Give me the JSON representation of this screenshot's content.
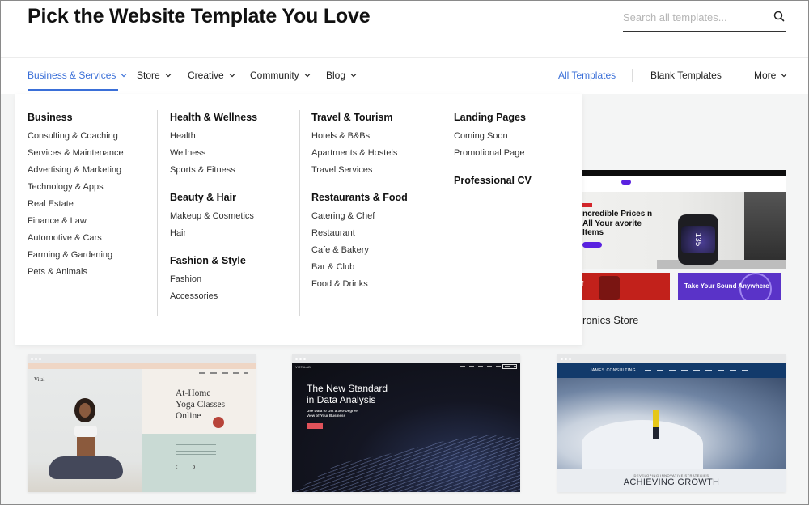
{
  "header": {
    "title": "Pick the Website Template You Love",
    "search_placeholder": "Search all templates...",
    "search_value": ""
  },
  "nav": {
    "left": [
      {
        "label": "Business & Services",
        "active": true,
        "has_dropdown": true
      },
      {
        "label": "Store",
        "active": false,
        "has_dropdown": true
      },
      {
        "label": "Creative",
        "active": false,
        "has_dropdown": true
      },
      {
        "label": "Community",
        "active": false,
        "has_dropdown": true
      },
      {
        "label": "Blog",
        "active": false,
        "has_dropdown": true
      }
    ],
    "right": [
      {
        "label": "All Templates",
        "active": true
      },
      {
        "label": "Blank Templates",
        "active": false
      },
      {
        "label": "More",
        "has_dropdown": true
      }
    ],
    "accent_color": "#3a6fd8"
  },
  "dropdown": {
    "columns": [
      {
        "groups": [
          {
            "title": "Business",
            "links": [
              "Consulting & Coaching",
              "Services & Maintenance",
              "Advertising & Marketing",
              "Technology & Apps",
              "Real Estate",
              "Finance & Law",
              "Automotive & Cars",
              "Farming & Gardening",
              "Pets & Animals"
            ]
          }
        ]
      },
      {
        "groups": [
          {
            "title": "Health & Wellness",
            "links": [
              "Health",
              "Wellness",
              "Sports & Fitness"
            ]
          },
          {
            "title": "Beauty & Hair",
            "links": [
              "Makeup & Cosmetics",
              "Hair"
            ]
          },
          {
            "title": "Fashion & Style",
            "links": [
              "Fashion",
              "Accessories"
            ]
          }
        ]
      },
      {
        "groups": [
          {
            "title": "Travel & Tourism",
            "links": [
              "Hotels & B&Bs",
              "Apartments & Hostels",
              "Travel Services"
            ]
          },
          {
            "title": "Restaurants & Food",
            "links": [
              "Catering & Chef",
              "Restaurant",
              "Cafe & Bakery",
              "Bar & Club",
              "Food & Drinks"
            ]
          }
        ]
      },
      {
        "groups": [
          {
            "title": "Landing Pages",
            "links": [
              "Coming Soon",
              "Promotional Page"
            ]
          },
          {
            "title": "Professional CV",
            "links": []
          }
        ]
      }
    ]
  },
  "templates": [
    {
      "name": "Electronics Store",
      "visible_name": "ronics Store",
      "preview": {
        "headline": "ncredible Prices n All Your avorite Items",
        "watch_text": "135",
        "promo_left": "o off",
        "promo_right": "Take Your Sound Anywhere"
      }
    },
    {
      "name": "",
      "preview": {
        "logo": "Vital",
        "headline_lines": [
          "At-Home",
          "Yoga Classes",
          "Online"
        ]
      }
    },
    {
      "name": "",
      "preview": {
        "brand": "VISTALAB",
        "headline_lines": [
          "The New Standard",
          "in Data Analysis"
        ],
        "sub_lines": [
          "Use Data to Get a 360-Degree",
          "View of Your Business"
        ]
      }
    },
    {
      "name": "",
      "preview": {
        "brand": "JAMES CONSULTING",
        "kicker": "DEVELOPING INNOVATIVE STRATEGIES",
        "headline": "ACHIEVING GROWTH"
      }
    }
  ]
}
